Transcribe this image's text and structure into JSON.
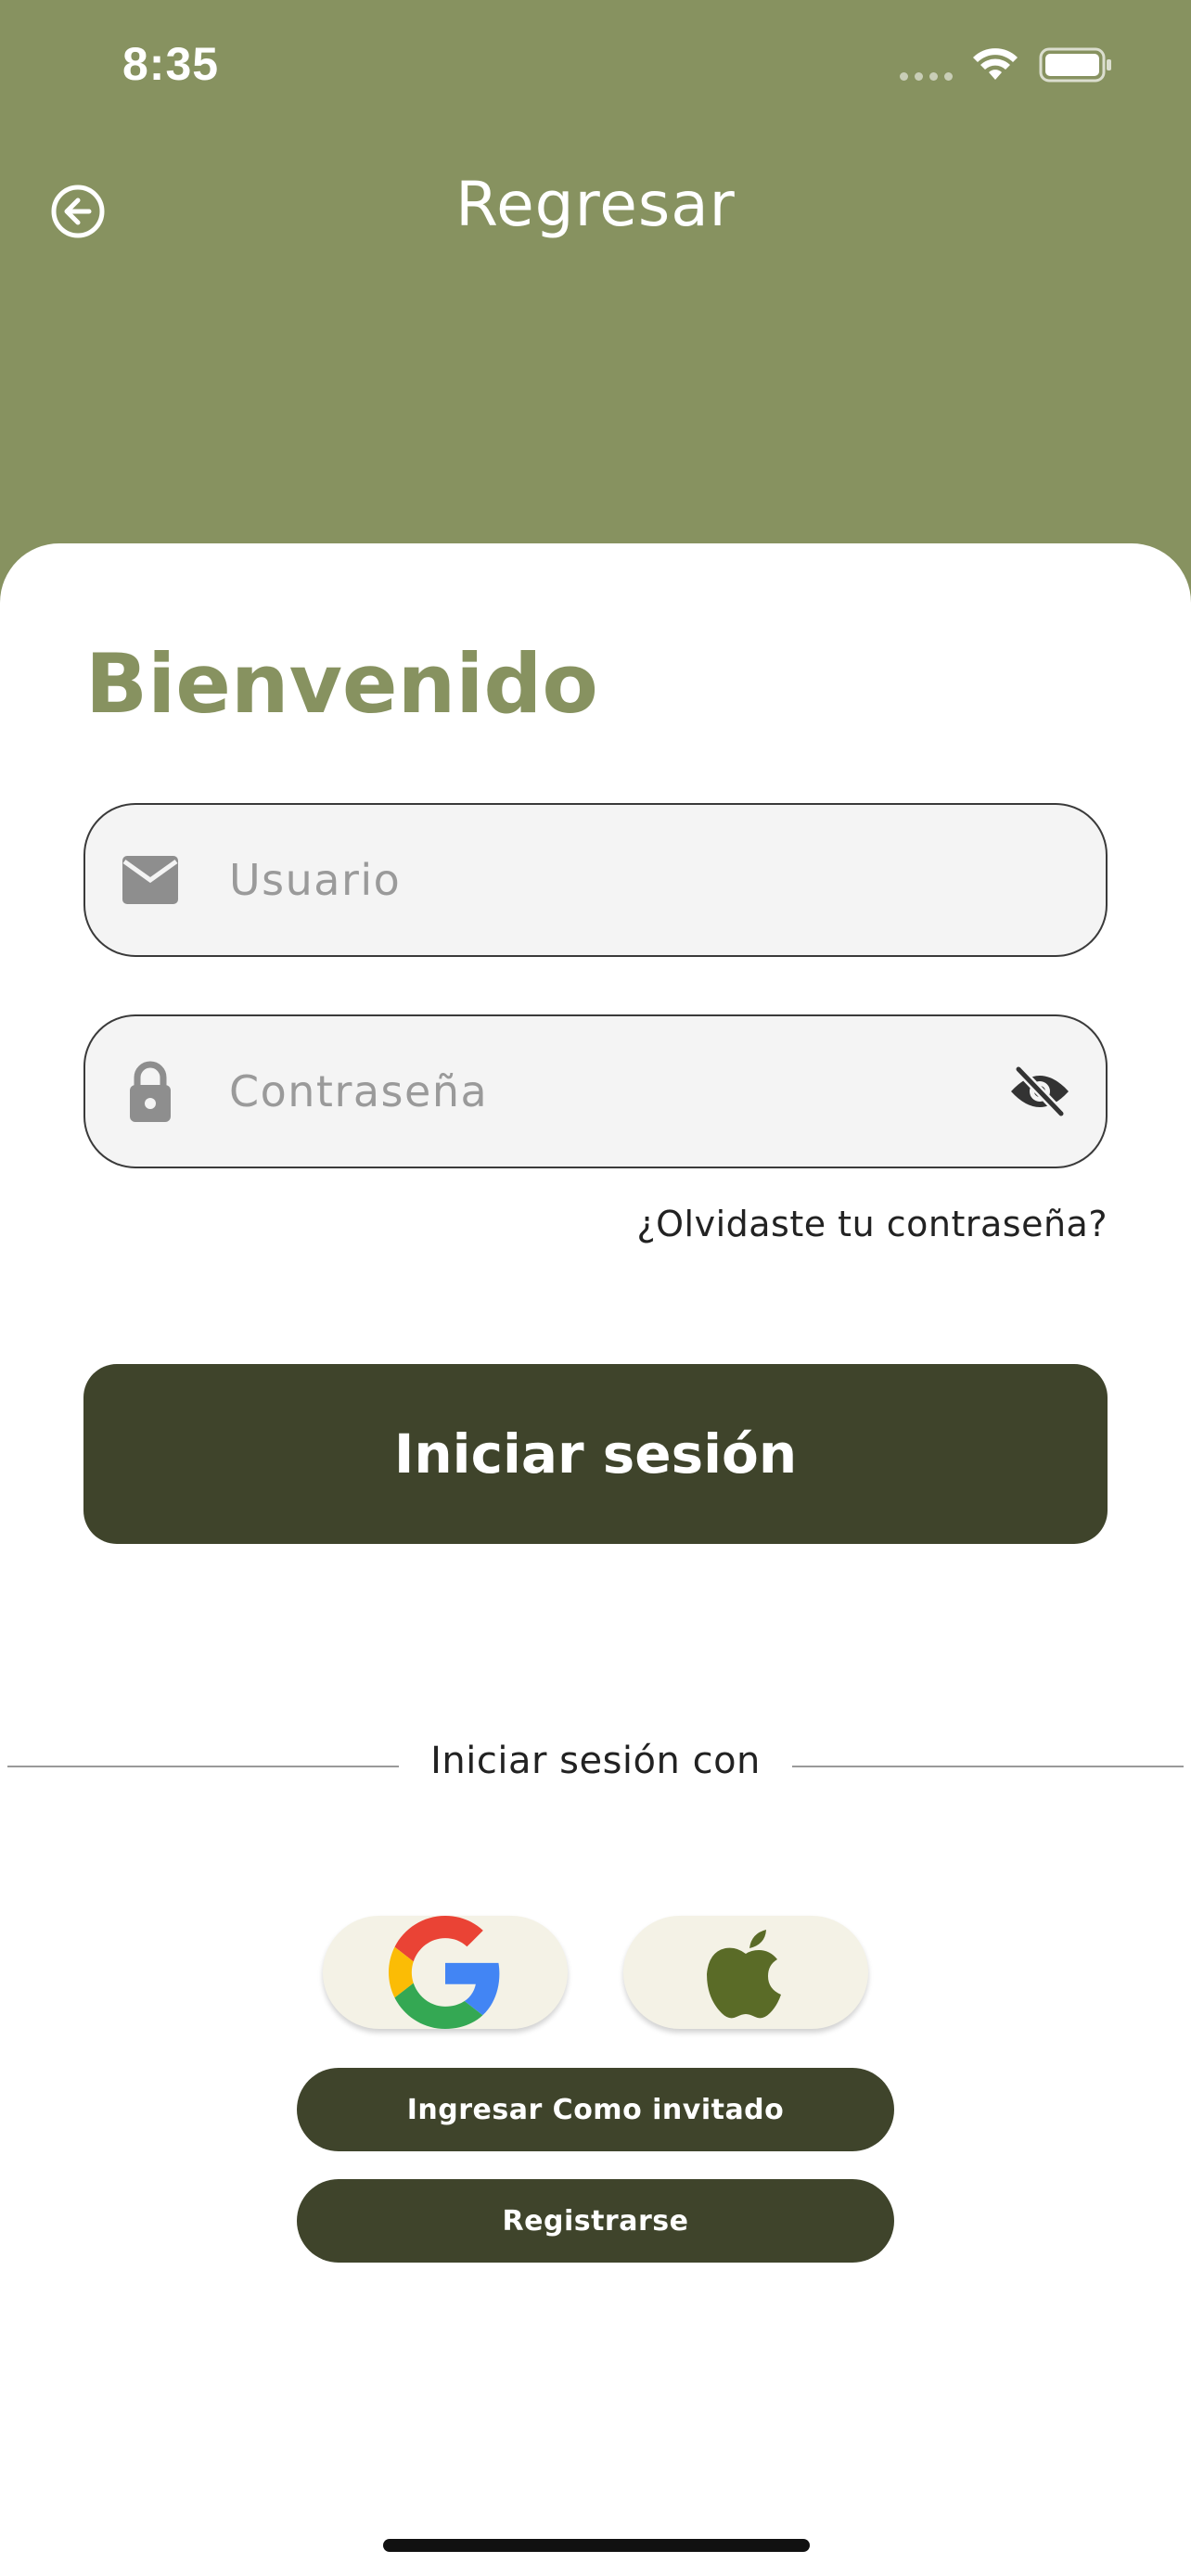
{
  "status_bar": {
    "time": "8:35"
  },
  "header": {
    "title": "Regresar",
    "back_icon": "circle-arrow-left-icon"
  },
  "login": {
    "welcome": "Bienvenido",
    "username_placeholder": "Usuario",
    "password_placeholder": "Contraseña",
    "forgot_password": "¿Olvidaste tu contraseña?",
    "submit_label": "Iniciar sesión"
  },
  "social": {
    "divider_label": "Iniciar sesión con",
    "providers": [
      "google-icon",
      "apple-icon"
    ]
  },
  "actions": {
    "guest_label": "Ingresar Como invitado",
    "register_label": "Registrarse"
  },
  "colors": {
    "header_bg": "#879260",
    "accent_dark": "#3f442b",
    "apple_green": "#5a6b27"
  }
}
